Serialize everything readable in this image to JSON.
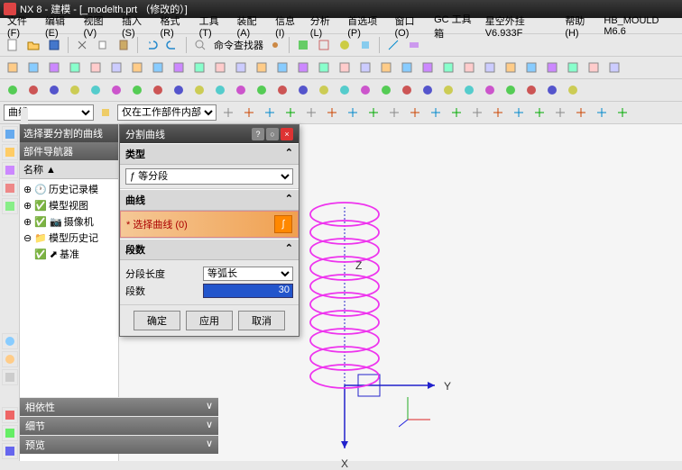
{
  "title": "NX 8 - 建模 - [_modelth.prt （修改的）]",
  "menu": [
    "文件(F)",
    "编辑(E)",
    "视图(V)",
    "插入(S)",
    "格式(R)",
    "工具(T)",
    "装配(A)",
    "信息(I)",
    "分析(L)",
    "首选项(P)",
    "窗口(O)",
    "GC 工具箱",
    "星空外挂 V6.933F",
    "帮助(H)",
    "HB_MOULD M6.6"
  ],
  "cmd_finder_label": "命令查找器",
  "filter_dropdown": "曲线",
  "scope_dropdown": "仅在工作部件内部",
  "sel_panel_title": "选择要分割的曲线",
  "nav": {
    "title": "部件导航器",
    "col": "名称",
    "items": [
      "历史记录模",
      "模型视图",
      "摄像机",
      "模型历史记",
      "基准"
    ]
  },
  "dialog": {
    "title": "分割曲线",
    "sec_type": "类型",
    "type_val": "等分段",
    "sec_curve": "曲线",
    "sel_curve": "* 选择曲线 (0)",
    "sec_seg": "段数",
    "len_label": "分段长度",
    "len_val": "等弧长",
    "count_label": "段数",
    "count_val": "30",
    "ok": "确定",
    "apply": "应用",
    "cancel": "取消"
  },
  "axes": {
    "x": "X",
    "y": "Y",
    "z": "Z"
  },
  "bottom_panels": [
    "相依性",
    "细节",
    "预览"
  ]
}
